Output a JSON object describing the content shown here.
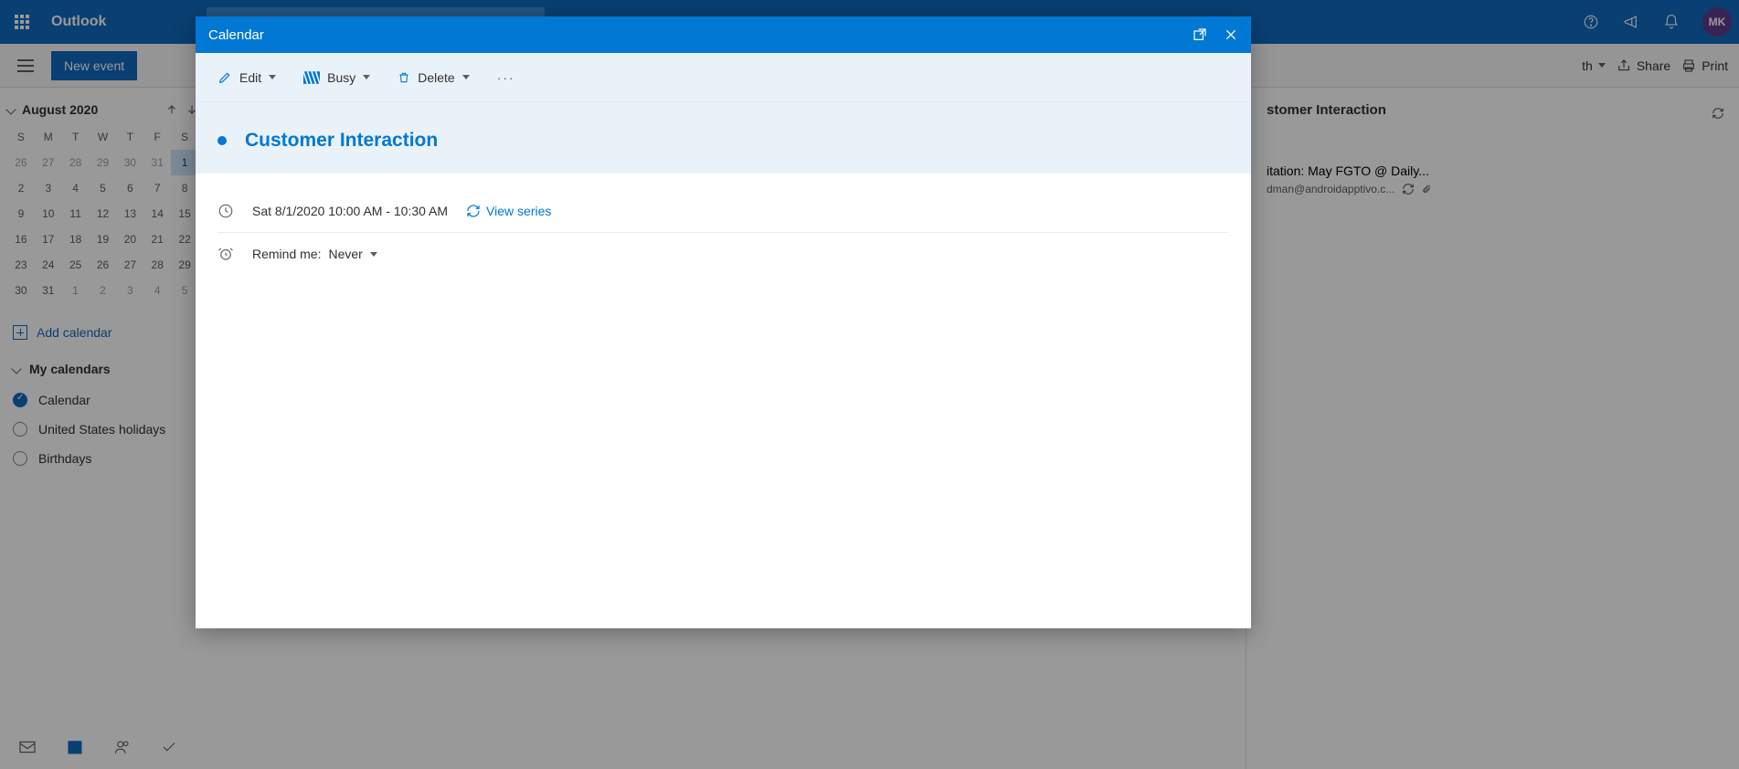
{
  "topbar": {
    "app_name": "Outlook",
    "avatar_initials": "MK"
  },
  "cmdrow": {
    "new_event": "New event",
    "view_label": "th",
    "share": "Share",
    "print": "Print"
  },
  "sidebar": {
    "month_label": "August 2020",
    "dow": [
      "S",
      "M",
      "T",
      "W",
      "T",
      "F",
      "S"
    ],
    "weeks": [
      [
        {
          "d": "26",
          "o": true
        },
        {
          "d": "27",
          "o": true
        },
        {
          "d": "28",
          "o": true
        },
        {
          "d": "29",
          "o": true
        },
        {
          "d": "30",
          "o": true
        },
        {
          "d": "31",
          "o": true
        },
        {
          "d": "1",
          "sel": true
        }
      ],
      [
        {
          "d": "2"
        },
        {
          "d": "3"
        },
        {
          "d": "4"
        },
        {
          "d": "5"
        },
        {
          "d": "6"
        },
        {
          "d": "7"
        },
        {
          "d": "8"
        }
      ],
      [
        {
          "d": "9"
        },
        {
          "d": "10"
        },
        {
          "d": "11"
        },
        {
          "d": "12"
        },
        {
          "d": "13"
        },
        {
          "d": "14"
        },
        {
          "d": "15"
        }
      ],
      [
        {
          "d": "16"
        },
        {
          "d": "17"
        },
        {
          "d": "18"
        },
        {
          "d": "19"
        },
        {
          "d": "20"
        },
        {
          "d": "21"
        },
        {
          "d": "22"
        }
      ],
      [
        {
          "d": "23"
        },
        {
          "d": "24"
        },
        {
          "d": "25"
        },
        {
          "d": "26"
        },
        {
          "d": "27"
        },
        {
          "d": "28"
        },
        {
          "d": "29"
        }
      ],
      [
        {
          "d": "30"
        },
        {
          "d": "31"
        },
        {
          "d": "1",
          "o": true
        },
        {
          "d": "2",
          "o": true
        },
        {
          "d": "3",
          "o": true
        },
        {
          "d": "4",
          "o": true
        },
        {
          "d": "5",
          "o": true
        }
      ]
    ],
    "add_calendar": "Add calendar",
    "my_calendars": "My calendars",
    "calendars": [
      {
        "label": "Calendar",
        "checked": true
      },
      {
        "label": "United States holidays",
        "checked": false
      },
      {
        "label": "Birthdays",
        "checked": false
      }
    ]
  },
  "right_preview": {
    "title": "stomer Interaction",
    "subtitle": "itation: May FGTO @ Daily...",
    "email": "dman@androidapptivo.c..."
  },
  "modal": {
    "header_title": "Calendar",
    "toolbar": {
      "edit": "Edit",
      "busy": "Busy",
      "delete": "Delete"
    },
    "event_title": "Customer Interaction",
    "datetime": "Sat 8/1/2020 10:00 AM - 10:30 AM",
    "view_series": "View series",
    "remind_label": "Remind me:",
    "remind_value": "Never"
  }
}
